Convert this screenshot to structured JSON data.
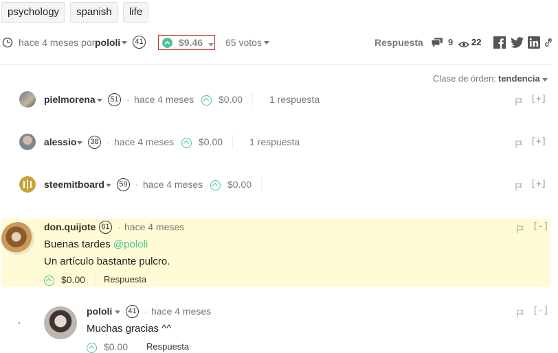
{
  "tags": [
    "psychology",
    "spanish",
    "life"
  ],
  "post_meta": {
    "time": "hace 4 meses por",
    "author": "pololi",
    "reputation": "41",
    "payout": "$9.46",
    "votes": "65 votos",
    "reply_label": "Respuesta",
    "comments_count": "9",
    "views_count": "22"
  },
  "sort": {
    "label": "Clase de órden:",
    "value": "tendencia"
  },
  "comments": [
    {
      "author": "pielmorena",
      "reputation": "51",
      "time": "hace 4 meses",
      "payout": "$0.00",
      "replies": "1 respuesta",
      "expand": "[+]"
    },
    {
      "author": "alessio",
      "reputation": "38",
      "time": "hace 4 meses",
      "payout": "$0.00",
      "replies": "1 respuesta",
      "expand": "[+]"
    },
    {
      "author": "steemitboard",
      "reputation": "59",
      "time": "hace 4 meses",
      "payout": "$0.00",
      "expand": "[+]"
    },
    {
      "author": "don.quijote",
      "reputation": "61",
      "time": "hace 4 meses",
      "body_prefix": "Buenas tardes",
      "mention": "@pololi",
      "body_line2": "Un artículo bastante pulcro.",
      "payout": "$0.00",
      "reply_label": "Respuesta",
      "expand": "[-]",
      "highlight": "#fffbd6"
    },
    {
      "author": "pololi",
      "reputation": "41",
      "time": "hace 4 meses",
      "body": "Muchas gracias ^^",
      "payout": "$0.00",
      "reply_label": "Respuesta",
      "expand": "[-]"
    }
  ],
  "colors": {
    "accent": "#4bc39b",
    "link": "#4bc39b",
    "highlight_box": "#cc3333"
  }
}
